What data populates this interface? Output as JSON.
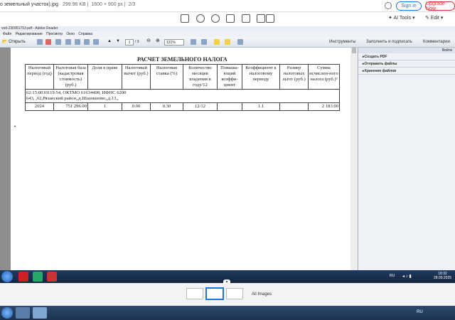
{
  "viewer": {
    "filename": "о земельный участок).jpg",
    "filesize": "299.96 KB",
    "dimensions": "1600 × 900 px",
    "counter": "2/3",
    "sign_in": "Sign in",
    "upgrade": "Upgrade Now",
    "ai_tools": "AI Tools",
    "edit": "Edit"
  },
  "adobe": {
    "window_title": "ved-230951753.pdf - Adobe Reader",
    "menu": [
      "Файл",
      "Редактирование",
      "Просмотр",
      "Окно",
      "Справка"
    ],
    "open": "Открыть",
    "page_current": "1",
    "page_total": "/ 3",
    "zoom": "131%",
    "right_tabs": [
      "Инструменты",
      "Заполнить и подписать",
      "Комментарии"
    ],
    "panel_header": "Войти",
    "panel_items": [
      "Создать PDF",
      "Отправить файлы",
      "Хранение файлов"
    ]
  },
  "document": {
    "title": "РАСЧЕТ ЗЕМЕЛЬНОГО НАЛОГА",
    "headers": [
      "Налоговый период (год)",
      "Налоговая база (кадастровая стоимость) (руб.)",
      "Доля в праве",
      "Налоговый вычет (руб.)",
      "Налоговая ставка (%)",
      "Количество месяцев владения в году/12",
      "Повыша-ющий коэффи-циент",
      "Коэффициент к налоговому периоду",
      "Размер налоговых льгот (руб.)",
      "Сумма исчислен-ного налога (руб.)³"
    ],
    "info_line1": "62:15:0010119:54, ОКТМО 61634498, ИФНС 6200",
    "info_line2": "643, ,62,Рязанский район,,д.Шахманово,,д.13,,",
    "row": [
      "2024",
      "751 296.00",
      "1",
      "0.00",
      "0.30",
      "12/12",
      "",
      "1.1",
      "",
      "2 183.00"
    ]
  },
  "taskbar": {
    "lang": "RU",
    "time": "18:32",
    "date": "28.09.2025"
  },
  "strip": {
    "all_images": "All Images"
  },
  "host": {
    "lang": "RU"
  }
}
